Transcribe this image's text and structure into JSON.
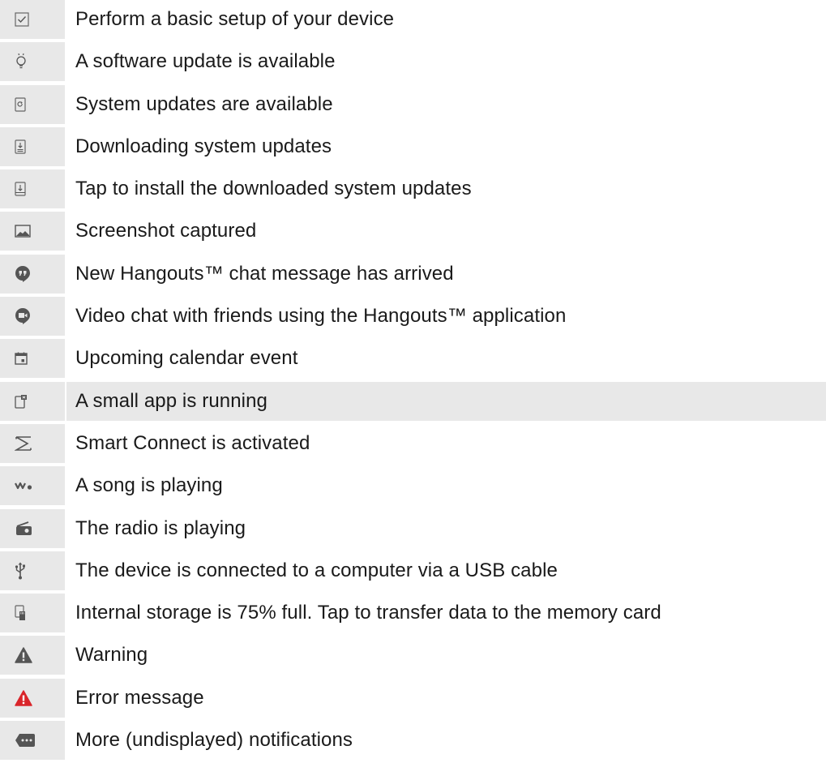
{
  "rows": [
    {
      "icon": "checkbox-checked-icon",
      "text": "Perform a basic setup of your device"
    },
    {
      "icon": "lightbulb-icon",
      "text": "A software update is available"
    },
    {
      "icon": "system-update-icon",
      "text": "System updates are available"
    },
    {
      "icon": "downloading-update-icon",
      "text": "Downloading system updates"
    },
    {
      "icon": "install-update-icon",
      "text": "Tap to install the downloaded system updates"
    },
    {
      "icon": "screenshot-icon",
      "text": "Screenshot captured"
    },
    {
      "icon": "hangouts-chat-icon",
      "text": "New Hangouts™ chat message has arrived"
    },
    {
      "icon": "hangouts-video-icon",
      "text": "Video chat with friends using the Hangouts™ application"
    },
    {
      "icon": "calendar-icon",
      "text": "Upcoming calendar event"
    },
    {
      "icon": "small-app-icon",
      "text": "A small app is running"
    },
    {
      "icon": "smart-connect-icon",
      "text": "Smart Connect is activated"
    },
    {
      "icon": "walkman-icon",
      "text": "A song is playing"
    },
    {
      "icon": "radio-icon",
      "text": "The radio is playing"
    },
    {
      "icon": "usb-icon",
      "text": "The device is connected to a computer via a USB cable"
    },
    {
      "icon": "storage-icon",
      "text": "Internal storage is 75% full. Tap to transfer data to the memory card"
    },
    {
      "icon": "warning-icon",
      "text": "Warning"
    },
    {
      "icon": "error-icon",
      "text": "Error message",
      "color": "#d9252a"
    },
    {
      "icon": "more-notifications-icon",
      "text": "More (undisplayed) notifications"
    }
  ],
  "colors": {
    "icon": "#555555",
    "error": "#d9252a",
    "cell_bg": "#e8e8e8"
  }
}
